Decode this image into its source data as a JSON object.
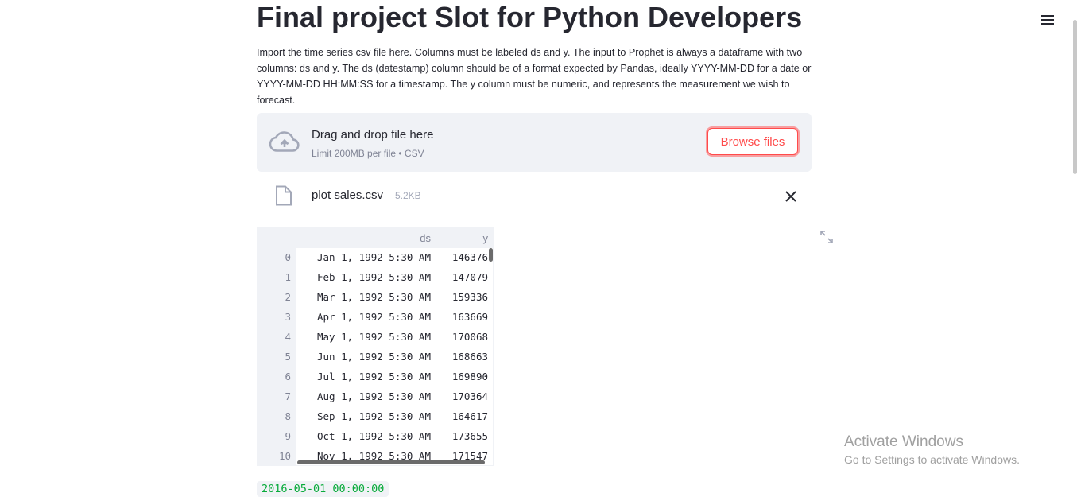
{
  "page": {
    "title": "Final project Slot for Python Developers",
    "description": "Import the time series csv file here. Columns must be labeled ds and y. The input to Prophet is always a dataframe with two columns: ds and y. The ds (datestamp) column should be of a format expected by Pandas, ideally YYYY-MM-DD for a date or YYYY-MM-DD HH:MM:SS for a timestamp. The y column must be numeric, and represents the measurement we wish to forecast."
  },
  "uploader": {
    "drag_label": "Drag and drop file here",
    "limit_label": "Limit 200MB per file • CSV",
    "browse_label": "Browse files",
    "file_name": "plot sales.csv",
    "file_size": "5.2KB"
  },
  "dataframe": {
    "columns": [
      "ds",
      "y"
    ],
    "rows": [
      {
        "idx": "0",
        "ds": "Jan 1, 1992 5:30 AM",
        "y": "146376"
      },
      {
        "idx": "1",
        "ds": "Feb 1, 1992 5:30 AM",
        "y": "147079"
      },
      {
        "idx": "2",
        "ds": "Mar 1, 1992 5:30 AM",
        "y": "159336"
      },
      {
        "idx": "3",
        "ds": "Apr 1, 1992 5:30 AM",
        "y": "163669"
      },
      {
        "idx": "4",
        "ds": "May 1, 1992 5:30 AM",
        "y": "170068"
      },
      {
        "idx": "5",
        "ds": "Jun 1, 1992 5:30 AM",
        "y": "168663"
      },
      {
        "idx": "6",
        "ds": "Jul 1, 1992 5:30 AM",
        "y": "169890"
      },
      {
        "idx": "7",
        "ds": "Aug 1, 1992 5:30 AM",
        "y": "170364"
      },
      {
        "idx": "8",
        "ds": "Sep 1, 1992 5:30 AM",
        "y": "164617"
      },
      {
        "idx": "9",
        "ds": "Oct 1, 1992 5:30 AM",
        "y": "173655"
      },
      {
        "idx": "10",
        "ds": "Nov 1, 1992 5:30 AM",
        "y": "171547"
      }
    ]
  },
  "result": {
    "value": "2016-05-01 00:00:00"
  },
  "watermark": {
    "title": "Activate Windows",
    "subtitle": "Go to Settings to activate Windows."
  },
  "icons": {
    "menu": "hamburger-menu-icon",
    "upload": "cloud-upload-icon",
    "file": "file-icon",
    "close": "close-icon",
    "expand": "fullscreen-expand-icon"
  },
  "colors": {
    "primary": "#ff4b4b",
    "text": "#262730",
    "muted": "#808495",
    "panel": "#f0f2f6",
    "code_green": "#09ab3b"
  }
}
